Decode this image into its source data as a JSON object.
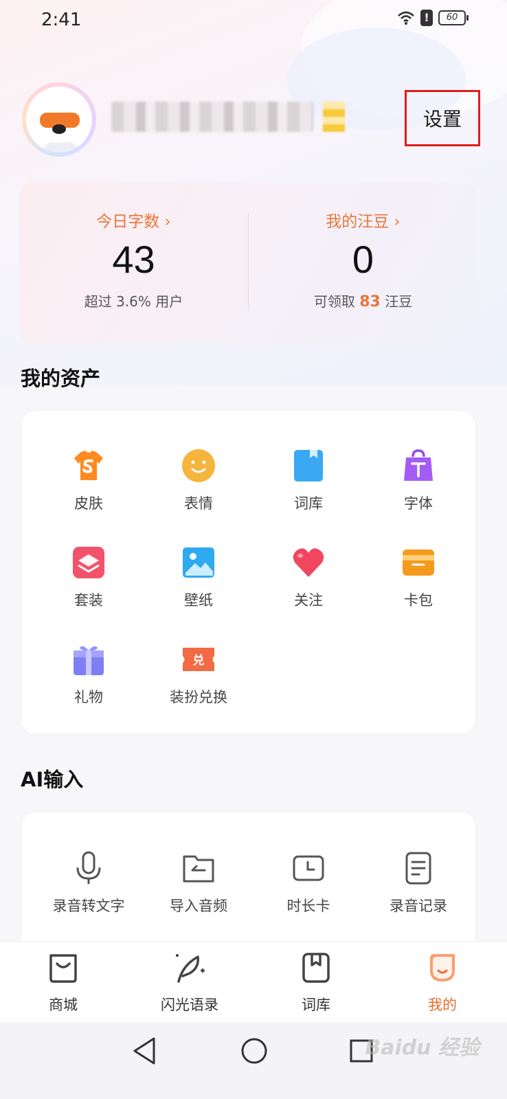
{
  "status_bar": {
    "time": "2:41",
    "battery": "60"
  },
  "profile": {
    "settings_label": "设置"
  },
  "stats": {
    "left": {
      "link": "今日字数 ›",
      "value": "43",
      "sub": "超过 3.6% 用户"
    },
    "right": {
      "link": "我的汪豆 ›",
      "value": "0",
      "sub_prefix": "可领取 ",
      "sub_highlight": "83",
      "sub_suffix": " 汪豆"
    }
  },
  "assets": {
    "title": "我的资产",
    "items": [
      {
        "label": "皮肤",
        "icon": "tshirt-icon"
      },
      {
        "label": "表情",
        "icon": "smiley-icon"
      },
      {
        "label": "词库",
        "icon": "book-icon"
      },
      {
        "label": "字体",
        "icon": "font-bag-icon"
      },
      {
        "label": "套装",
        "icon": "layers-icon"
      },
      {
        "label": "壁纸",
        "icon": "image-icon"
      },
      {
        "label": "关注",
        "icon": "heart-icon"
      },
      {
        "label": "卡包",
        "icon": "wallet-icon"
      },
      {
        "label": "礼物",
        "icon": "gift-icon"
      },
      {
        "label": "装扮兑换",
        "icon": "redeem-ticket-icon"
      }
    ]
  },
  "ai_input": {
    "title": "AI输入",
    "items": [
      {
        "label": "录音转文字",
        "icon": "microphone-icon"
      },
      {
        "label": "导入音频",
        "icon": "folder-import-icon"
      },
      {
        "label": "时长卡",
        "icon": "clock-card-icon"
      },
      {
        "label": "录音记录",
        "icon": "document-icon"
      }
    ]
  },
  "bottom_nav": {
    "items": [
      {
        "label": "商城",
        "icon": "shopping-bag-icon"
      },
      {
        "label": "闪光语录",
        "icon": "quill-sparkle-icon"
      },
      {
        "label": "词库",
        "icon": "bookmark-book-icon"
      },
      {
        "label": "我的",
        "icon": "profile-shield-icon",
        "active": true
      }
    ]
  },
  "watermark": "Baidu 经验",
  "colors": {
    "accent": "#ee6a2c",
    "highlight_border": "#e01c1c"
  }
}
